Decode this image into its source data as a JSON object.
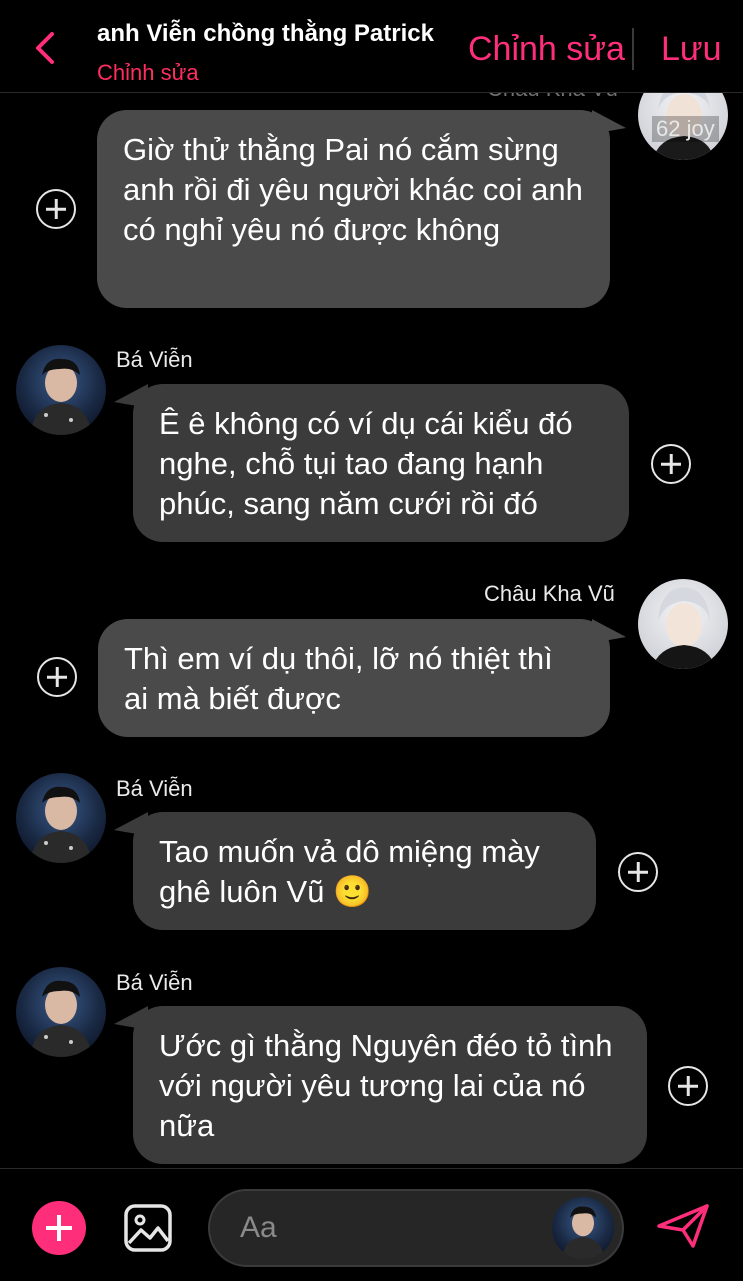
{
  "header": {
    "title": "anh Viễn chồng thằng Patrick",
    "subtitle": "Chỉnh sửa",
    "edit_label": "Chỉnh sửa",
    "save_label": "Lưu"
  },
  "badges": {
    "join_text": "62 joy",
    "cut_name": "Châu Kha Vũ"
  },
  "messages": [
    {
      "sender": "",
      "side": "right",
      "text": "Giờ thử thằng Pai nó cắm sừng anh rồi đi yêu người khác coi anh có nghỉ yêu nó được không"
    },
    {
      "sender": "Bá Viễn",
      "side": "left",
      "text": "Ê ê không có ví dụ cái kiểu đó nghe, chỗ tụi tao đang hạnh phúc, sang năm cưới rồi đó"
    },
    {
      "sender": "Châu Kha Vũ",
      "side": "right",
      "text": "Thì em ví dụ thôi, lỡ nó thiệt thì ai mà biết được"
    },
    {
      "sender": "Bá Viễn",
      "side": "left",
      "text": "Tao muốn vả dô miệng mày ghê luôn Vũ 🙂"
    },
    {
      "sender": "Bá Viễn",
      "side": "left",
      "text": "Ước gì thằng Nguyên đéo tỏ tình với người yêu tương lai của nó nữa"
    }
  ],
  "composer": {
    "placeholder": "Aa"
  },
  "colors": {
    "accent": "#ff2e7a",
    "bubble_right": "#4a4a4a",
    "bubble_left": "#3b3b3b",
    "background": "#000000"
  }
}
